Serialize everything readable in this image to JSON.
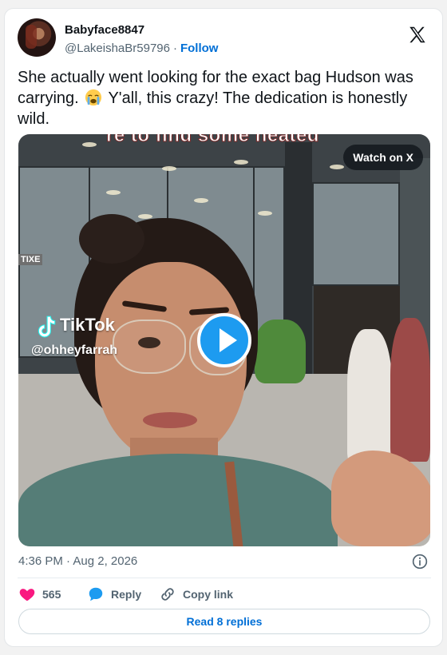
{
  "author": {
    "display_name": "Babyface8847",
    "handle": "@LakeishaBr59796",
    "separator": "·",
    "follow_label": "Follow"
  },
  "tweet": {
    "text_part1": "She actually went looking for the exact bag Hudson was carrying.",
    "emoji": "loudly-crying-face",
    "text_part2": "Y'all, this crazy! The dedication is honestly wild."
  },
  "media": {
    "overlay_caption": "re to find some heated",
    "watch_label": "Watch on X",
    "tiktok_label": "TikTok",
    "tiktok_handle": "@ohheyfarrah",
    "store_sign": "TIXE"
  },
  "meta": {
    "timestamp": "4:36 PM · Aug 2, 2026"
  },
  "actions": {
    "like_count": "565",
    "reply_label": "Reply",
    "copy_label": "Copy link"
  },
  "footer": {
    "read_replies_label": "Read 8 replies"
  },
  "colors": {
    "link": "#006fd6",
    "like": "#f91880",
    "reply_icon": "#1d9bf0",
    "play_button": "#1d9bf0"
  },
  "icons": [
    "x-logo-icon",
    "heart-icon",
    "reply-bubble-icon",
    "link-icon",
    "info-icon",
    "play-icon",
    "tiktok-logo-icon"
  ]
}
